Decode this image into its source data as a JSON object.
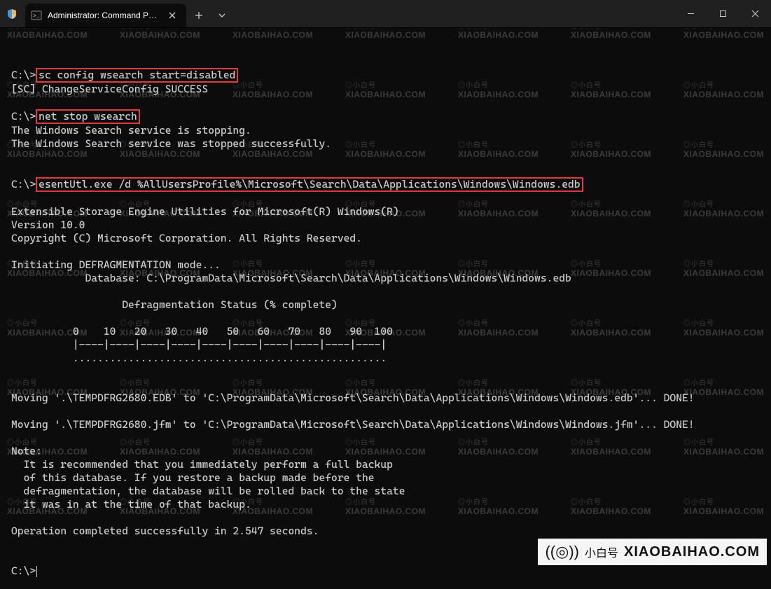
{
  "window": {
    "tab_title": "Administrator: Command Prompt"
  },
  "watermark": {
    "cn": "◎小白号",
    "en": "XIAOBAIHAO.COM",
    "big_cn": "小白号",
    "big_en": "XIAOBAIHAO.COM"
  },
  "term": {
    "prompt": "C:\\>",
    "cmd1": "sc config wsearch start=disabled",
    "out1": "[SC] ChangeServiceConfig SUCCESS",
    "cmd2": "net stop wsearch",
    "out2a": "The Windows Search service is stopping.",
    "out2b": "The Windows Search service was stopped successfully.",
    "cmd3": "esentUtl.exe /d %AllUsersProfile%\\Microsoft\\Search\\Data\\Applications\\Windows\\Windows.edb",
    "out3a": "Extensible Storage Engine Utilities for Microsoft(R) Windows(R)",
    "out3b": "Version 10.0",
    "out3c": "Copyright (C) Microsoft Corporation. All Rights Reserved.",
    "out3d": "Initiating DEFRAGMENTATION mode...",
    "out3e": "            Database: C:\\ProgramData\\Microsoft\\Search\\Data\\Applications\\Windows\\Windows.edb",
    "out3f": "                  Defragmentation Status (% complete)",
    "out3g": "          0    10   20   30   40   50   60   70   80   90  100",
    "out3h": "          |----|----|----|----|----|----|----|----|----|----|",
    "out3i": "          ...................................................",
    "out3j": "Moving '.\\TEMPDFRG2680.EDB' to 'C:\\ProgramData\\Microsoft\\Search\\Data\\Applications\\Windows\\Windows.edb'... DONE!",
    "out3k": "Moving '.\\TEMPDFRG2680.jfm' to 'C:\\ProgramData\\Microsoft\\Search\\Data\\Applications\\Windows\\Windows.jfm'... DONE!",
    "out3l": "Note:",
    "out3m": "  It is recommended that you immediately perform a full backup",
    "out3n": "  of this database. If you restore a backup made before the",
    "out3o": "  defragmentation, the database will be rolled back to the state",
    "out3p": "  it was in at the time of that backup.",
    "out3q": "Operation completed successfully in 2.547 seconds."
  }
}
